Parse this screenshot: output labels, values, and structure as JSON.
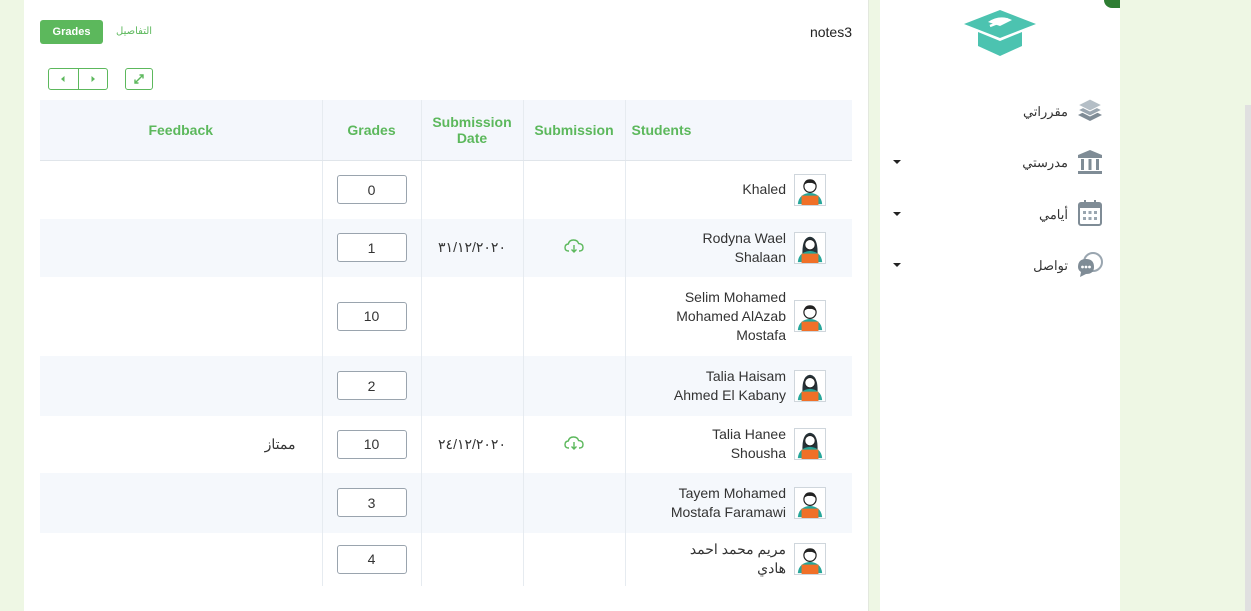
{
  "header": {
    "grades_button": "Grades",
    "details_link": "التفاصيل",
    "title": "notes3"
  },
  "table": {
    "columns": {
      "feedback": "Feedback",
      "grades": "Grades",
      "submission_date": "Submission Date",
      "submission": "Submission",
      "students": "Students"
    },
    "rows": [
      {
        "name": "Khaled",
        "grade": "0",
        "date": "",
        "submitted": false,
        "feedback": "",
        "gender": "male"
      },
      {
        "name": "Rodyna Wael Shalaan",
        "grade": "1",
        "date": "٣١/١٢/٢٠٢٠",
        "submitted": true,
        "feedback": "",
        "gender": "female"
      },
      {
        "name": "Selim Mohamed Mohamed AlAzab Mostafa",
        "grade": "10",
        "date": "",
        "submitted": false,
        "feedback": "",
        "gender": "male"
      },
      {
        "name": "Talia Haisam Ahmed El Kabany",
        "grade": "2",
        "date": "",
        "submitted": false,
        "feedback": "",
        "gender": "female"
      },
      {
        "name": "Talia Hanee Shousha",
        "grade": "10",
        "date": "٢٤/١٢/٢٠٢٠",
        "submitted": true,
        "feedback": "ممتاز",
        "gender": "female"
      },
      {
        "name": "Tayem Mohamed Mostafa Faramawi",
        "grade": "3",
        "date": "",
        "submitted": false,
        "feedback": "",
        "gender": "male"
      },
      {
        "name": "مريم محمد احمد هادي",
        "grade": "4",
        "date": "",
        "submitted": false,
        "feedback": "",
        "gender": "male"
      }
    ]
  },
  "sidebar": {
    "items": [
      {
        "label": "مقرراتي",
        "icon": "layers-icon",
        "has_dropdown": false
      },
      {
        "label": "مدرستي",
        "icon": "school-building-icon",
        "has_dropdown": true
      },
      {
        "label": "أيامي",
        "icon": "calendar-icon",
        "has_dropdown": true
      },
      {
        "label": "تواصل",
        "icon": "chat-bubbles-icon",
        "has_dropdown": true
      }
    ]
  },
  "colors": {
    "accent": "#5cb85c",
    "logo": "#4cc3b0",
    "header_bg": "#f4f7fc",
    "avatar_teal": "#26a69a",
    "avatar_orange": "#f07028"
  }
}
